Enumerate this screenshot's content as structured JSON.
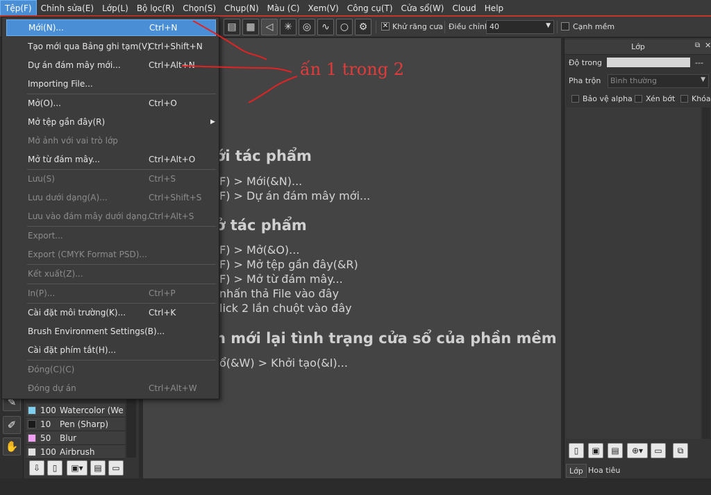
{
  "menubar": {
    "items": [
      "Tệp(F)",
      "Chỉnh sửa(E)",
      "Lớp(L)",
      "Bộ lọc(R)",
      "Chọn(S)",
      "Chụp(N)",
      "Màu (C)",
      "Xem(V)",
      "Công cụ(T)",
      "Cửa sổ(W)",
      "Cloud",
      "Help"
    ]
  },
  "toolbar": {
    "antialias_label": "Khử răng cưa",
    "adjust_label": "Điều chỉnh",
    "adjust_value": "40",
    "soft_edge_label": "Cạnh mềm"
  },
  "file_menu": {
    "items": [
      {
        "label": "Mới(N)...",
        "shortcut": "Ctrl+N"
      },
      {
        "label": "Tạo mới qua Bảng ghi tạm(V)",
        "shortcut": "Ctrl+Shift+N"
      },
      {
        "label": "Dự án đám mây mới...",
        "shortcut": "Ctrl+Alt+N"
      },
      {
        "label": "Importing File...",
        "shortcut": ""
      },
      {
        "label": "Mở(O)...",
        "shortcut": "Ctrl+O"
      },
      {
        "label": "Mở tệp gần đây(R)",
        "shortcut": ""
      },
      {
        "label": "Mở ảnh với vai trò lớp",
        "shortcut": ""
      },
      {
        "label": "Mở từ đám mây...",
        "shortcut": "Ctrl+Alt+O"
      },
      {
        "label": "Lưu(S)",
        "shortcut": "Ctrl+S"
      },
      {
        "label": "Lưu dưới dạng(A)...",
        "shortcut": "Ctrl+Shift+S"
      },
      {
        "label": "Lưu vào đám mây dưới dạng...",
        "shortcut": "Ctrl+Alt+S"
      },
      {
        "label": "Export...",
        "shortcut": ""
      },
      {
        "label": "Export (CMYK Format PSD)...",
        "shortcut": ""
      },
      {
        "label": "Kết xuất(Z)...",
        "shortcut": ""
      },
      {
        "label": "In(P)...",
        "shortcut": "Ctrl+P"
      },
      {
        "label": "Cài đặt môi trường(K)...",
        "shortcut": "Ctrl+K"
      },
      {
        "label": "Brush Environment Settings(B)...",
        "shortcut": ""
      },
      {
        "label": "Cài đặt phím tắt(H)...",
        "shortcut": ""
      },
      {
        "label": "Đóng(C)(C)",
        "shortcut": ""
      },
      {
        "label": "Đóng dự án",
        "shortcut": "Ctrl+Alt+W"
      }
    ]
  },
  "annotation": "ấn 1 trong 2",
  "canvas_help": {
    "h1": "ới tác phẩm",
    "l1": "F) > Mới(&N)...",
    "l2": "F) > Dự án đám mây mới...",
    "h2": "ở tác phẩm",
    "l3": "F) > Mở(&O)...",
    "l4": "F) > Mở tệp gần đây(&R)",
    "l5": "F) > Mở từ đám mây...",
    "l6": "nhấn thả File vào đây",
    "l7": "lick 2 lần chuột vào đây",
    "h3": "n mới lại tình trạng cửa sổ của phần mềm",
    "l8": "ổ(&W) > Khởi tạo(&I)..."
  },
  "brushes": [
    {
      "size": "100",
      "name": "Watercolor (We",
      "color": "#7fd0f0"
    },
    {
      "size": "10",
      "name": "Pen (Sharp)",
      "color": "#1a1a1a"
    },
    {
      "size": "50",
      "name": "Blur",
      "color": "#f0a0f0"
    },
    {
      "size": "100",
      "name": "Airbrush",
      "color": "#e0e0e0"
    }
  ],
  "layer_panel": {
    "title": "Lớp",
    "opacity_label": "Độ trong",
    "opacity_value": "---",
    "blend_label": "Pha trộn",
    "blend_value": "Bình thường",
    "protect_alpha": "Bảo vệ alpha",
    "clipping": "Xén bớt",
    "lock": "Khóa",
    "tab_layer": "Lớp",
    "tab_navigator": "Hoa tiêu"
  }
}
